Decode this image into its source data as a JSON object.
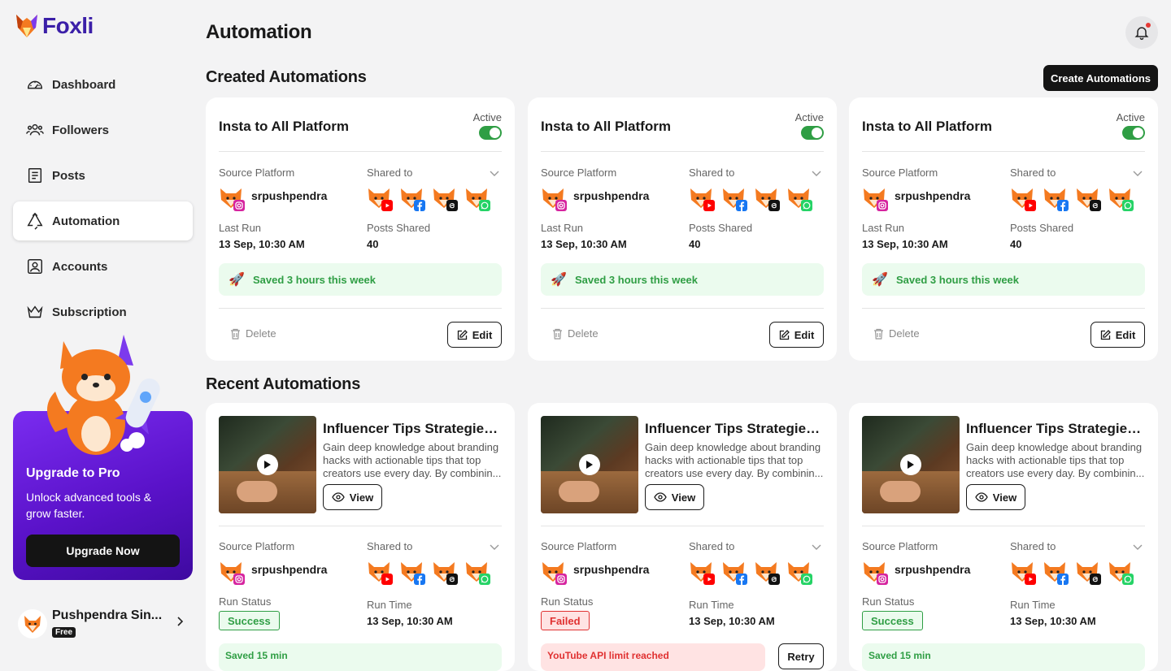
{
  "app": {
    "name": "Foxli"
  },
  "sidebar": {
    "items": [
      {
        "label": "Dashboard",
        "icon": "dashboard-icon"
      },
      {
        "label": "Followers",
        "icon": "users-icon"
      },
      {
        "label": "Posts",
        "icon": "posts-icon"
      },
      {
        "label": "Automation",
        "icon": "recycle-icon",
        "active": true
      },
      {
        "label": "Accounts",
        "icon": "account-icon"
      },
      {
        "label": "Subscription",
        "icon": "crown-icon"
      }
    ],
    "promo": {
      "title": "Upgrade to Pro",
      "subtitle": "Unlock advanced tools & grow faster.",
      "button": "Upgrade Now"
    },
    "user": {
      "name": "Pushpendra Sin...",
      "plan": "Free"
    }
  },
  "header": {
    "title": "Automation"
  },
  "created": {
    "title": "Created Automations",
    "create_button": "Create Automations",
    "cards": [
      {
        "title": "Insta to All Platform",
        "active_label": "Active",
        "source_label": "Source Platform",
        "shared_label": "Shared to",
        "user": "srpushpendra",
        "last_run_label": "Last Run",
        "last_run": "13 Sep, 10:30 AM",
        "posts_shared_label": "Posts Shared",
        "posts_shared": "40",
        "saved": "Saved 3 hours this week",
        "delete": "Delete",
        "edit": "Edit"
      },
      {
        "title": "Insta to All Platform",
        "active_label": "Active",
        "source_label": "Source Platform",
        "shared_label": "Shared to",
        "user": "srpushpendra",
        "last_run_label": "Last Run",
        "last_run": "13 Sep, 10:30 AM",
        "posts_shared_label": "Posts Shared",
        "posts_shared": "40",
        "saved": "Saved 3 hours this week",
        "delete": "Delete",
        "edit": "Edit"
      },
      {
        "title": "Insta to All Platform",
        "active_label": "Active",
        "source_label": "Source Platform",
        "shared_label": "Shared to",
        "user": "srpushpendra",
        "last_run_label": "Last Run",
        "last_run": "13 Sep, 10:30 AM",
        "posts_shared_label": "Posts Shared",
        "posts_shared": "40",
        "saved": "Saved 3 hours this week",
        "delete": "Delete",
        "edit": "Edit"
      }
    ]
  },
  "recent": {
    "title": "Recent Automations",
    "cards": [
      {
        "title": "Influencer Tips Strategies,...",
        "desc": "Gain deep knowledge about branding hacks with actionable tips that top creators use every day. By combinin...",
        "view": "View",
        "source_label": "Source Platform",
        "shared_label": "Shared to",
        "user": "srpushpendra",
        "status_label": "Run Status",
        "status": "Success",
        "run_time_label": "Run Time",
        "run_time": "13 Sep, 10:30 AM",
        "note": "Saved 15 min"
      },
      {
        "title": "Influencer Tips Strategies,...",
        "desc": "Gain deep knowledge about branding hacks with actionable tips that top creators use every day. By combinin...",
        "view": "View",
        "source_label": "Source Platform",
        "shared_label": "Shared to",
        "user": "srpushpendra",
        "status_label": "Run Status",
        "status": "Failed",
        "run_time_label": "Run Time",
        "run_time": "13 Sep, 10:30 AM",
        "note": "YouTube API limit reached",
        "retry": "Retry"
      },
      {
        "title": "Influencer Tips Strategies,...",
        "desc": "Gain deep knowledge about branding hacks with actionable tips that top creators use every day. By combinin...",
        "view": "View",
        "source_label": "Source Platform",
        "shared_label": "Shared to",
        "user": "srpushpendra",
        "status_label": "Run Status",
        "status": "Success",
        "run_time_label": "Run Time",
        "run_time": "13 Sep, 10:30 AM",
        "note": "Saved 15 min"
      }
    ]
  },
  "colors": {
    "brand": "#3b1fa8",
    "promo": "#6a1fe0",
    "success": "#2f9e44",
    "error": "#e03131"
  }
}
